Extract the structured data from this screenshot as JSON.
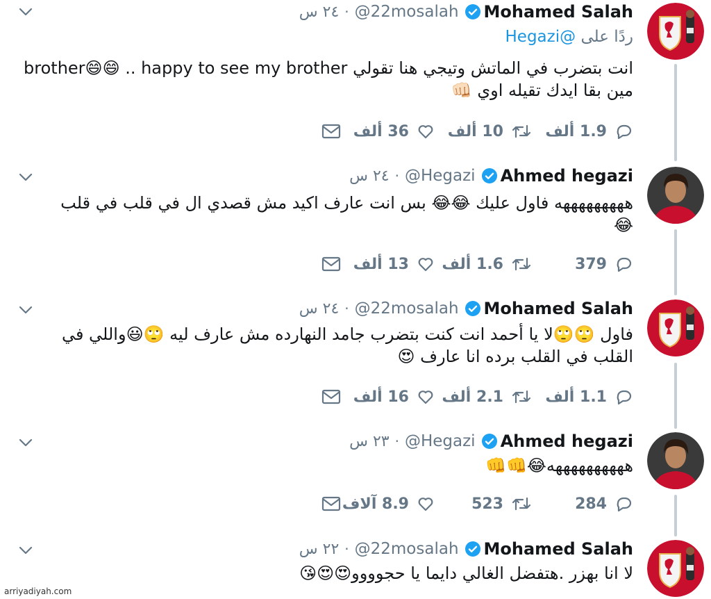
{
  "tweets": [
    {
      "name": "Mohamed Salah",
      "handle": "@22mosalah",
      "time": "٢٤ س",
      "avatar": "liverpool-crest",
      "reply_prefix": "ردًا على",
      "reply_to": "@Hegazi",
      "lines": [
        "انت بتضرب في الماتش وتيجي هنا تقولي brother😄😄 .. happy to see my brother",
        "مين بقا ايدك تقيله اوي 👊🏻"
      ],
      "reply_count": "1.9 ألف",
      "retweet_count": "10 ألف",
      "like_count": "36 ألف"
    },
    {
      "name": "Ahmed hegazi",
      "handle": "@Hegazi",
      "time": "٢٤ س",
      "avatar": "player-photo",
      "lines": [
        "هههههههههه فاول عليك 😂😂 بس انت عارف اكيد مش قصدي ال في قلب في قلب",
        "😂"
      ],
      "reply_count": "379",
      "retweet_count": "1.6 ألف",
      "like_count": "13 ألف"
    },
    {
      "name": "Mohamed Salah",
      "handle": "@22mosalah",
      "time": "٢٤ س",
      "avatar": "liverpool-crest",
      "lines": [
        "فاول 🙄🙄لا يا أحمد انت كنت بتضرب جامد النهارده مش عارف ليه 🙄😃واللي في",
        "القلب في القلب برده انا عارف 😍"
      ],
      "reply_count": "1.1 ألف",
      "retweet_count": "2.1 ألف",
      "like_count": "16 ألف"
    },
    {
      "name": "Ahmed hegazi",
      "handle": "@Hegazi",
      "time": "٢٣ س",
      "avatar": "player-photo",
      "lines": [
        "ههههههههههه😂👊👊"
      ],
      "reply_count": "284",
      "retweet_count": "523",
      "like_count": "8.9 آلاف"
    },
    {
      "name": "Mohamed Salah",
      "handle": "@22mosalah",
      "time": "٢٢ س",
      "avatar": "liverpool-crest",
      "lines": [
        "لا انا بهزر .هتفضل الغالي دايما يا حجوووو😍😍😘"
      ]
    }
  ],
  "watermark": "arriyadiyah.com",
  "colors": {
    "verified": "#1da1f2",
    "mention": "#1b95e0",
    "secondary_text": "#657786",
    "thread_line": "#c4cfd6",
    "crest_red": "#c8102e"
  }
}
